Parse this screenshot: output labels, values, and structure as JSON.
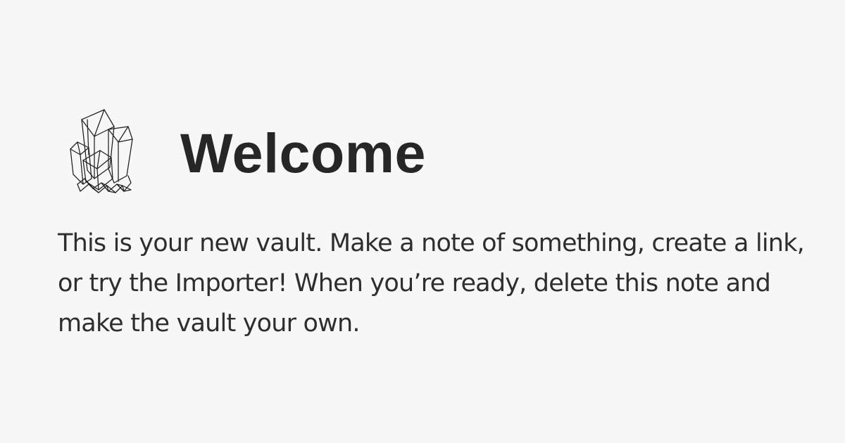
{
  "note": {
    "icon": "crystal-icon",
    "title": "Welcome",
    "body": "This is your new vault. Make a note of something, create a link, or try the Importer! When you’re ready, delete this note and make the vault your own."
  },
  "colors": {
    "background": "#f8f7f8",
    "text": "#2a2a2a"
  }
}
